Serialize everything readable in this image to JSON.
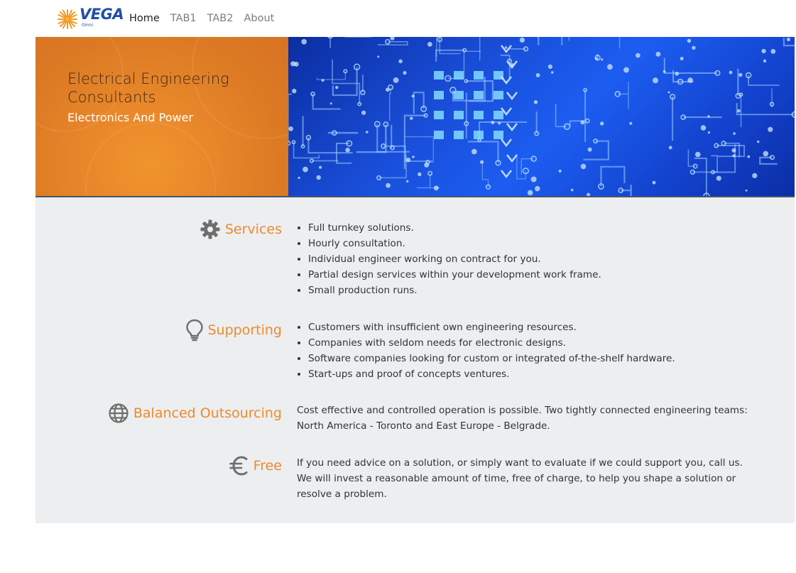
{
  "logo": {
    "word": "VEGA",
    "sub": "Omni"
  },
  "nav": {
    "links": [
      {
        "label": "Home",
        "active": true
      },
      {
        "label": "TAB1",
        "active": false
      },
      {
        "label": "TAB2",
        "active": false
      },
      {
        "label": "About",
        "active": false
      }
    ]
  },
  "hero": {
    "title": "Electrical Engineering Consultants",
    "subtitle": "Electronics And Power"
  },
  "sections": [
    {
      "title": "Services",
      "icon": "gear-icon",
      "items": [
        "Full turnkey solutions.",
        "Hourly consultation.",
        "Individual engineer working on contract for you.",
        "Partial design services within your development work frame.",
        "Small production runs."
      ]
    },
    {
      "title": "Supporting",
      "icon": "lightbulb-icon",
      "items": [
        "Customers with insufficient own engineering resources.",
        "Companies with seldom needs for electronic designs.",
        "Software companies looking for custom or integrated of-the-shelf hardware.",
        "Start-ups and proof of concepts ventures."
      ]
    },
    {
      "title": "Balanced Outsourcing",
      "icon": "globe-icon",
      "text": "Cost effective and controlled operation is possible. Two tightly connected engineering teams: North America - Toronto and East Europe - Belgrade."
    },
    {
      "title": "Free",
      "icon": "euro-icon",
      "text": "If you need advice on a solution, or simply want to evaluate if we could support you, call us. We will invest a reasonable amount of time, free of charge, to help you shape a solution or resolve a problem."
    }
  ],
  "colors": {
    "accent": "#ed8a2a",
    "hero_orange": "#e8862a",
    "hero_blue": "#1d5ef0",
    "content_bg": "#eceef0",
    "icon_gray": "#6e6e6e"
  }
}
